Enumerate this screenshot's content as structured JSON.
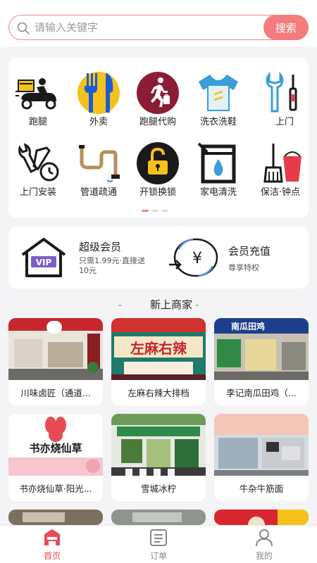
{
  "search": {
    "placeholder": "请输入关键字",
    "button_label": "搜索"
  },
  "services": {
    "row1": [
      {
        "label": "跑腿",
        "icon": "scooter-courier-icon"
      },
      {
        "label": "外卖",
        "icon": "fork-knife-icon"
      },
      {
        "label": "跑腿代购",
        "icon": "running-shopper-icon"
      },
      {
        "label": "洗衣洗鞋",
        "icon": "tshirt-icon"
      },
      {
        "label": "上门",
        "icon": "tools-icon"
      }
    ],
    "row2": [
      {
        "label": "上门安装",
        "icon": "wrench-install-icon"
      },
      {
        "label": "管道疏通",
        "icon": "pipe-icon"
      },
      {
        "label": "开锁换锁",
        "icon": "padlock-icon"
      },
      {
        "label": "家电清洗",
        "icon": "appliance-wash-icon"
      },
      {
        "label": "保洁·钟点",
        "icon": "broom-bucket-icon"
      }
    ]
  },
  "member": {
    "vip_title": "超级会员",
    "vip_sub": "只需1.99元·直接送10元",
    "vip_badge": "VIP",
    "recharge_title": "会员充值",
    "recharge_sub": "尊享特权",
    "recharge_symbol": "¥"
  },
  "section": {
    "dash_left": "-",
    "title": "新上商家",
    "dash_right": "-"
  },
  "merchants": [
    {
      "name": "川味卤匠（通道...",
      "sign": ""
    },
    {
      "name": "左麻右辣大排档",
      "sign": "左麻右辣"
    },
    {
      "name": "李记南瓜田鸡（...",
      "sign": "南瓜田鸡"
    },
    {
      "name": "书亦烧仙草·阳光...",
      "sign": "书亦烧仙草"
    },
    {
      "name": "雪城冰柠",
      "sign": ""
    },
    {
      "name": "牛杂牛筋面",
      "sign": ""
    }
  ],
  "tabs": [
    {
      "label": "首页"
    },
    {
      "label": "订单"
    },
    {
      "label": "我的"
    }
  ],
  "colors": {
    "accent": "#f47c7c",
    "active_tab": "#e84b55",
    "icon_black": "#1a1a1a",
    "icon_yellow": "#f5c21b",
    "icon_maroon": "#8c1c36",
    "icon_blue": "#3a9ed8",
    "icon_red": "#e83a4a"
  }
}
